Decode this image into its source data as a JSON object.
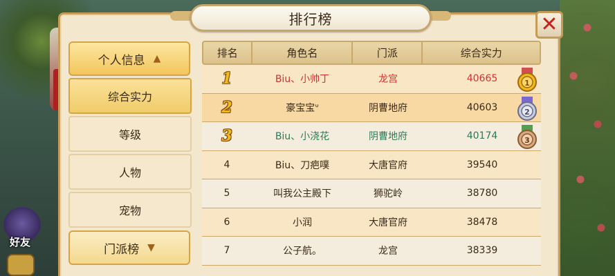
{
  "title": "排行榜",
  "background": {
    "friend_label": "好友"
  },
  "menu": {
    "header": "个人信息",
    "items": [
      {
        "label": "综合实力",
        "active": true
      },
      {
        "label": "等级",
        "active": false
      },
      {
        "label": "人物",
        "active": false
      },
      {
        "label": "宠物",
        "active": false
      }
    ],
    "section2": "门派榜"
  },
  "table": {
    "headers": {
      "rank": "排名",
      "name": "角色名",
      "school": "门派",
      "power": "综合实力"
    },
    "rows": [
      {
        "rank": "1",
        "name": "Biu、小帅丁",
        "school": "龙宫",
        "power": "40665",
        "medal": "gold"
      },
      {
        "rank": "2",
        "name": "豪宝宝ᐡ",
        "school": "阴曹地府",
        "power": "40603",
        "medal": "silver"
      },
      {
        "rank": "3",
        "name": "Biu、小浇花",
        "school": "阴曹地府",
        "power": "40174",
        "medal": "bronze"
      },
      {
        "rank": "4",
        "name": "Biu、刀疤噗",
        "school": "大唐官府",
        "power": "39540"
      },
      {
        "rank": "5",
        "name": "叫我公主殿下",
        "school": "狮驼岭",
        "power": "38780"
      },
      {
        "rank": "6",
        "name": "小润",
        "school": "大唐官府",
        "power": "38478"
      },
      {
        "rank": "7",
        "name": "公子航。",
        "school": "龙宫",
        "power": "38339"
      }
    ]
  },
  "colors": {
    "gold": "#f2b91f",
    "red_text": "#d43030",
    "green_text": "#2a7a5a",
    "panel": "#f3e7cd",
    "border": "#c59b57"
  }
}
